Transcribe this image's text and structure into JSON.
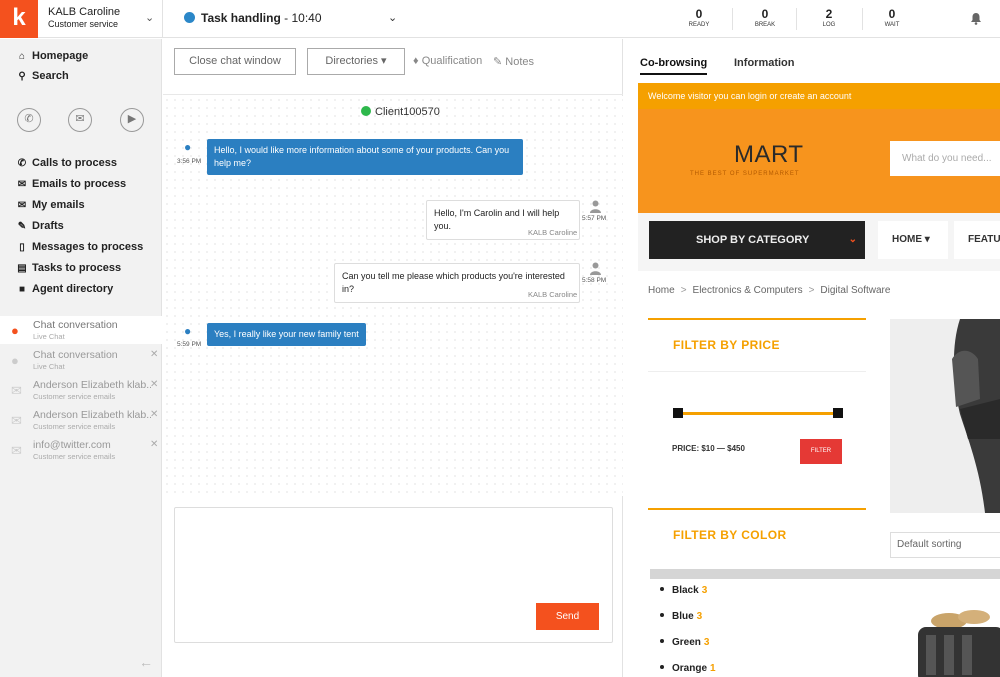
{
  "topbar": {
    "logo": "k",
    "user_name": "KALB Caroline",
    "user_role": "Customer service",
    "task_label": "Task handling",
    "task_time": "10:40",
    "counters": [
      {
        "num": "0",
        "label": "READY"
      },
      {
        "num": "0",
        "label": "BREAK"
      },
      {
        "num": "2",
        "label": "LOG"
      },
      {
        "num": "0",
        "label": "WAIT"
      }
    ]
  },
  "sidebar": {
    "top_items": [
      {
        "label": "Homepage",
        "icon": "home-icon"
      },
      {
        "label": "Search",
        "icon": "search-icon"
      }
    ],
    "items": [
      {
        "label": "Calls to process",
        "icon": "phone-icon"
      },
      {
        "label": "Emails to process",
        "icon": "envelope-icon"
      },
      {
        "label": "My emails",
        "icon": "inbox-icon"
      },
      {
        "label": "Drafts",
        "icon": "pencil-icon"
      },
      {
        "label": "Messages to process",
        "icon": "mobile-icon"
      },
      {
        "label": "Tasks to process",
        "icon": "list-icon"
      },
      {
        "label": "Agent directory",
        "icon": "contact-icon"
      }
    ],
    "conversations": [
      {
        "title": "Chat conversation",
        "sub": "Live Chat",
        "active": true,
        "icon": "chat-icon"
      },
      {
        "title": "Chat conversation",
        "sub": "Live Chat",
        "active": false,
        "icon": "chat-icon"
      },
      {
        "title": "Anderson Elizabeth klab...",
        "sub": "Customer service emails",
        "active": false,
        "icon": "envelope-icon"
      },
      {
        "title": "Anderson Elizabeth klab...",
        "sub": "Customer service emails",
        "active": false,
        "icon": "envelope-icon"
      },
      {
        "title": "info@twitter.com",
        "sub": "Customer service emails",
        "active": false,
        "icon": "envelope-icon"
      }
    ]
  },
  "chat": {
    "close_button": "Close chat window",
    "directories_button": "Directories",
    "qualification": "Qualification",
    "notes": "Notes",
    "client": "Client100570",
    "messages": [
      {
        "dir": "in",
        "text": "Hello, I would like more information about some of your products. Can you help me?",
        "time": "3:56 PM"
      },
      {
        "dir": "out",
        "text": "Hello, I'm Carolin and I will help you.",
        "time": "5:57 PM",
        "sender": "KALB Caroline"
      },
      {
        "dir": "out",
        "text": "Can you tell me please which products you're interested in?",
        "time": "5:58 PM",
        "sender": "KALB Caroline"
      },
      {
        "dir": "in",
        "text": "Yes, I really like your new family tent",
        "time": "5:59 PM"
      }
    ],
    "send_label": "Send"
  },
  "right": {
    "tabs": [
      "Co-browsing",
      "Information"
    ],
    "site": {
      "welcome": "Welcome visitor you can login or create an account",
      "brand": "MART",
      "tagline": "THE BEST OF SUPERMARKET",
      "search_placeholder": "What do you need...",
      "shop_by_category": "SHOP BY CATEGORY",
      "nav": [
        "HOME",
        "FEATU"
      ],
      "breadcrumbs": [
        "Home",
        "Electronics & Computers",
        "Digital Software"
      ],
      "filter_price_title": "FILTER BY PRICE",
      "price_label": "PRICE: $10 — $450",
      "filter_button": "FILTER",
      "filter_color_title": "FILTER BY COLOR",
      "sorting": "Default sorting",
      "colors": [
        {
          "name": "Black",
          "count": "3"
        },
        {
          "name": "Blue",
          "count": "3"
        },
        {
          "name": "Green",
          "count": "3"
        },
        {
          "name": "Orange",
          "count": "1"
        }
      ]
    }
  },
  "colors": {
    "accent": "#f4511e",
    "chat_blue": "#2b7fc1",
    "site_orange": "#f7941d",
    "status_green": "#2eb84c"
  }
}
